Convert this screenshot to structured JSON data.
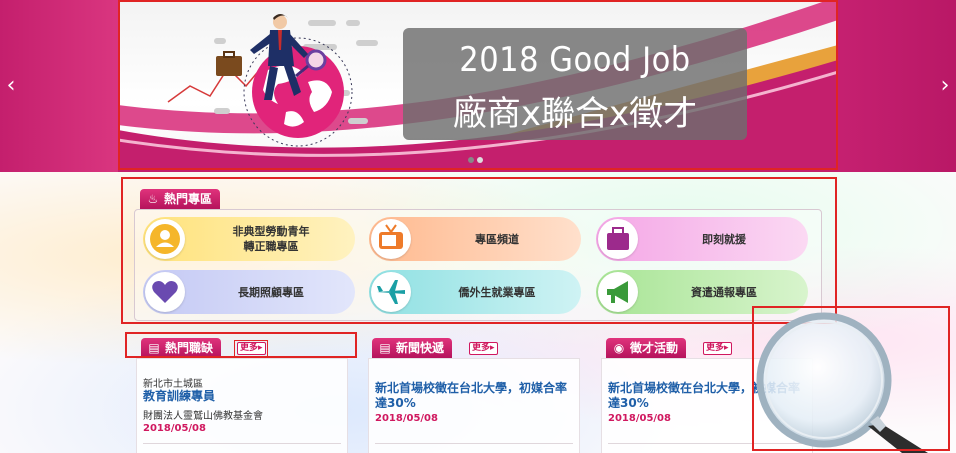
{
  "banner": {
    "title_line1": "2018 Good Job",
    "title_line2": "廠商x聯合x徵才",
    "prev_arrow": "‹",
    "next_arrow": "›",
    "slide_count": 2,
    "active_slide": 1,
    "colors": {
      "primary": "#c41f6d",
      "accent": "#e8a23c"
    }
  },
  "hot_zone": {
    "title": "熱門專區",
    "icon": "flame-icon",
    "items": [
      {
        "label_line1": "非典型勞動青年",
        "label_line2": "轉正職專區",
        "icon": "user-icon",
        "color": "#ffe99a"
      },
      {
        "label_line1": "專區頻道",
        "label_line2": "",
        "icon": "tv-icon",
        "color": "#ffc7a3"
      },
      {
        "label_line1": "即刻就援",
        "label_line2": "",
        "icon": "briefcase-icon",
        "color": "#f7c0ec"
      },
      {
        "label_line1": "長期照顧專區",
        "label_line2": "",
        "icon": "heart-icon",
        "color": "#cdd5f7"
      },
      {
        "label_line1": "僑外生就業專區",
        "label_line2": "",
        "icon": "airplane-icon",
        "color": "#b9ecee"
      },
      {
        "label_line1": "資遣通報專區",
        "label_line2": "",
        "icon": "megaphone-icon",
        "color": "#c7f0b8"
      }
    ]
  },
  "columns": [
    {
      "title": "熱門職缺",
      "icon": "briefcase-icon",
      "more": "更多▸",
      "item": {
        "location": "新北市土城區",
        "job_title": "教育訓練專員",
        "org": "財團法人靈鷲山佛教基金會",
        "date": "2018/05/08"
      }
    },
    {
      "title": "新聞快遞",
      "icon": "newspaper-icon",
      "more": "更多▸",
      "item": {
        "headline": "新北首場校徵在台北大學，初媒合率達30%",
        "date": "2018/05/08"
      }
    },
    {
      "title": "徵才活動",
      "icon": "binoculars-icon",
      "more": "更多▸",
      "item": {
        "headline": "新北首場校徵在台北大學，初媒合率達30%",
        "date": "2018/05/08"
      }
    }
  ]
}
